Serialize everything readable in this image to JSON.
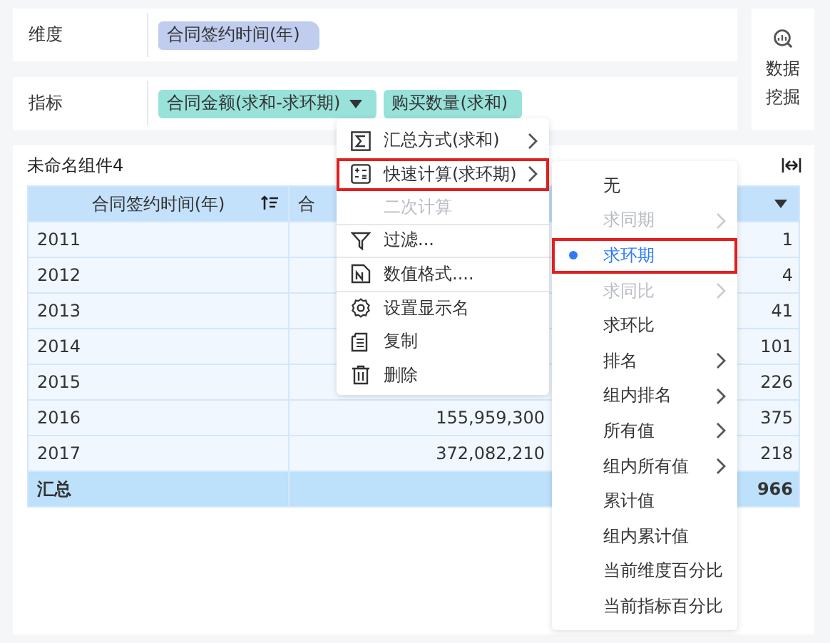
{
  "dimension_row": {
    "label": "维度",
    "chips": [
      {
        "text": "合同签约时间(年)",
        "kind": "dimension",
        "dropdown": false
      }
    ]
  },
  "indicator_row": {
    "label": "指标",
    "chips": [
      {
        "text": "合同金额(求和-求环期)",
        "kind": "indicator",
        "dropdown": true
      },
      {
        "text": "购买数量(求和)",
        "kind": "indicator",
        "dropdown": false
      }
    ]
  },
  "side_button": {
    "label": "数据挖掘"
  },
  "component": {
    "title": "未命名组件4",
    "table": {
      "columns": [
        {
          "label": "合同签约时间(年)",
          "sort": true,
          "dropdown": false
        },
        {
          "label": "合",
          "sort": false,
          "dropdown": false
        },
        {
          "sort": false,
          "dropdown": true
        }
      ],
      "rows": [
        {
          "year": "2011",
          "column_3": "1"
        },
        {
          "year": "2012",
          "column_3": "4"
        },
        {
          "year": "2013",
          "column_3": "41"
        },
        {
          "year": "2014",
          "column_3": "101"
        },
        {
          "year": "2015",
          "column_3": "226"
        },
        {
          "year": "2016",
          "column_2": "155,959,300",
          "column_3": "375"
        },
        {
          "year": "2017",
          "column_2": "372,082,210",
          "column_3": "218"
        }
      ],
      "summary": {
        "label": "汇总",
        "column_3": "966"
      }
    }
  },
  "context_menu": {
    "items": [
      {
        "label": "汇总方式(求和)",
        "disabled": false,
        "submenu": true,
        "selected": false,
        "divider_after": false
      },
      {
        "label": "快速计算(求环期)",
        "disabled": false,
        "submenu": true,
        "selected": true,
        "divider_after": false
      },
      {
        "label": "二次计算",
        "disabled": true,
        "submenu": false,
        "selected": false,
        "divider_after": true
      },
      {
        "label": "过滤...",
        "disabled": false,
        "submenu": false,
        "selected": false,
        "divider_after": true
      },
      {
        "label": "数值格式....",
        "disabled": false,
        "submenu": false,
        "selected": false,
        "divider_after": true
      },
      {
        "label": "设置显示名",
        "disabled": false,
        "submenu": false,
        "selected": false,
        "divider_after": false
      },
      {
        "label": "复制",
        "disabled": false,
        "submenu": false,
        "selected": false,
        "divider_after": false
      },
      {
        "label": "删除",
        "disabled": false,
        "submenu": false,
        "selected": false,
        "divider_after": false
      }
    ]
  },
  "submenu": {
    "items": [
      {
        "label": "无",
        "selected": false,
        "disabled": false,
        "submenu": false
      },
      {
        "label": "求同期",
        "selected": false,
        "disabled": true,
        "submenu": true
      },
      {
        "label": "求环期",
        "selected": true,
        "disabled": false,
        "submenu": false
      },
      {
        "label": "求同比",
        "selected": false,
        "disabled": true,
        "submenu": true
      },
      {
        "label": "求环比",
        "selected": false,
        "disabled": false,
        "submenu": false
      },
      {
        "label": "排名",
        "selected": false,
        "disabled": false,
        "submenu": true
      },
      {
        "label": "组内排名",
        "selected": false,
        "disabled": false,
        "submenu": true
      },
      {
        "label": "所有值",
        "selected": false,
        "disabled": false,
        "submenu": true
      },
      {
        "label": "组内所有值",
        "selected": false,
        "disabled": false,
        "submenu": true
      },
      {
        "label": "累计值",
        "selected": false,
        "disabled": false,
        "submenu": false
      },
      {
        "label": "组内累计值",
        "selected": false,
        "disabled": false,
        "submenu": false
      },
      {
        "label": "当前维度百分比",
        "selected": false,
        "disabled": false,
        "submenu": false
      },
      {
        "label": "当前指标百分比",
        "selected": false,
        "disabled": false,
        "submenu": false
      }
    ]
  }
}
